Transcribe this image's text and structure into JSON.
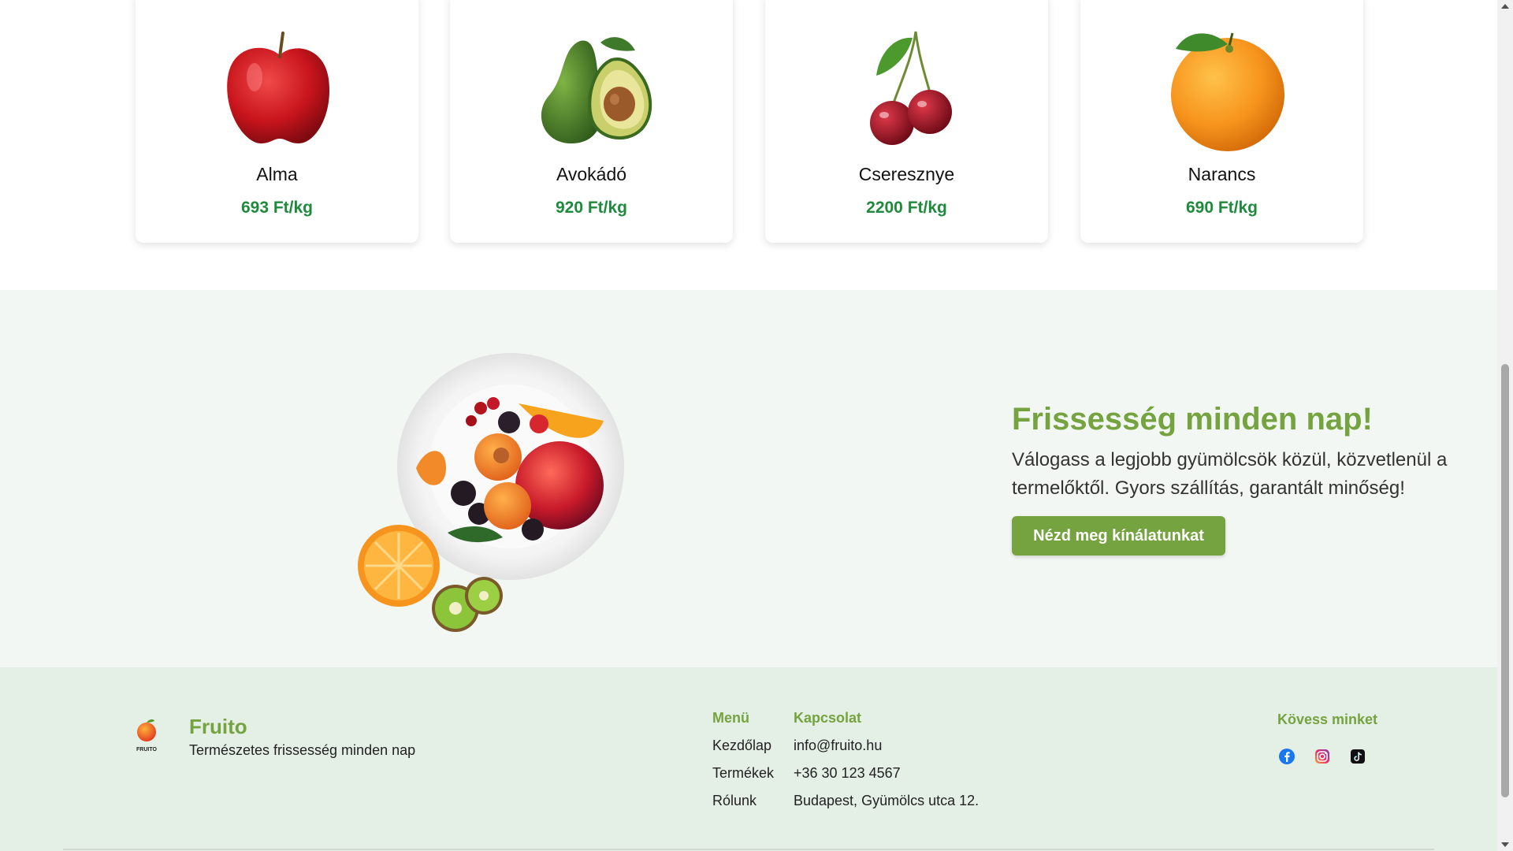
{
  "products": [
    {
      "name": "Alma",
      "price": "693 Ft/kg",
      "icon": "apple-image"
    },
    {
      "name": "Avokádó",
      "price": "920 Ft/kg",
      "icon": "avocado-image"
    },
    {
      "name": "Cseresznye",
      "price": "2200 Ft/kg",
      "icon": "cherry-image"
    },
    {
      "name": "Narancs",
      "price": "690 Ft/kg",
      "icon": "orange-image"
    }
  ],
  "hero": {
    "title": "Frissesség minden nap!",
    "lead": "Válogass a legjobb gyümölcsök közül, közvetlenül a termelőktől. Gyors szállítás, garantált minőség!",
    "cta_label": "Nézd meg kínálatunkat",
    "image": "fruit-plate-image"
  },
  "footer": {
    "logo_text": "FRUITO",
    "brand": "Fruito",
    "tagline": "Természetes frissesség minden nap",
    "menu": {
      "title": "Menü",
      "items": [
        "Kezdőlap",
        "Termékek",
        "Rólunk"
      ]
    },
    "contact": {
      "title": "Kapcsolat",
      "items": [
        "info@fruito.hu",
        "+36 30 123 4567",
        "Budapest, Gyümölcs utca 12."
      ]
    },
    "social": {
      "title": "Kövess minket",
      "icons": [
        "facebook-icon",
        "instagram-icon",
        "tiktok-icon"
      ]
    }
  },
  "colors": {
    "accent": "#74a33f",
    "price": "#1e8a3c",
    "hero_bg": "#f2f7f3",
    "footer_bg": "#e4efe6"
  }
}
